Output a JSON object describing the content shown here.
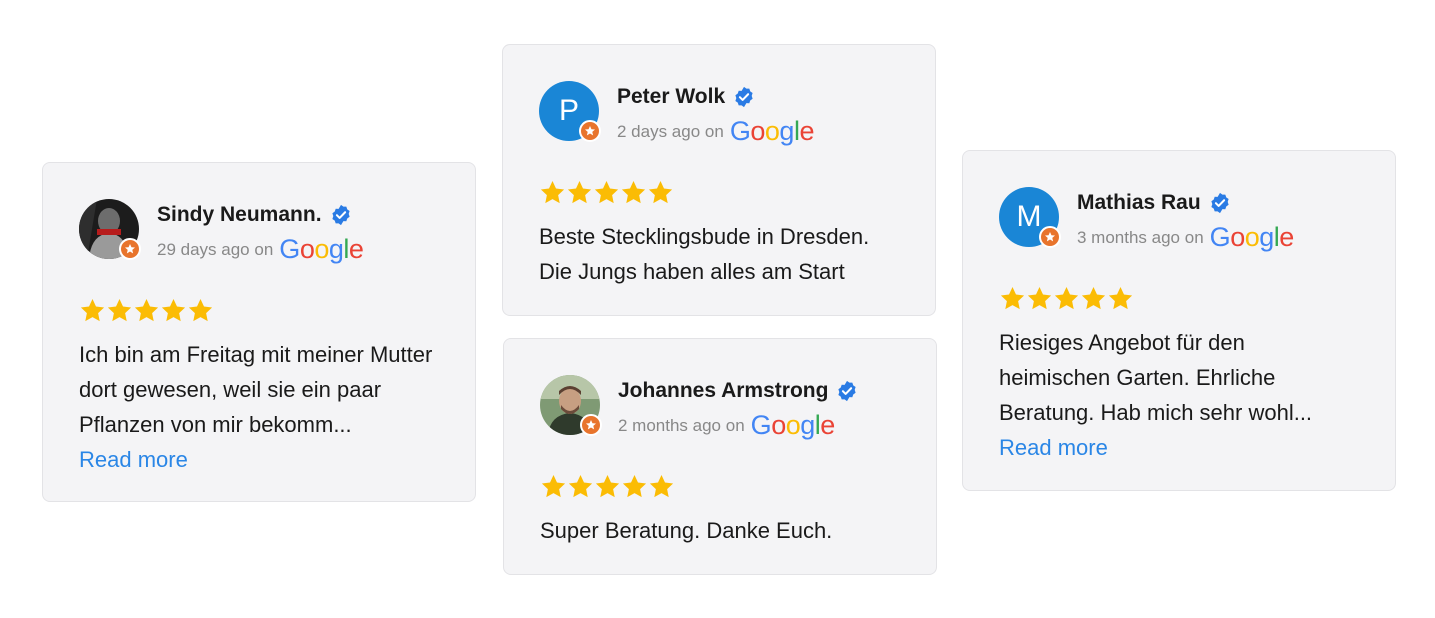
{
  "source_label": "Google",
  "on_label": "on",
  "read_more_label": "Read more",
  "colors": {
    "card_bg": "#f4f4f6",
    "star": "#fbbc04",
    "verified": "#2a7be4",
    "link": "#2a86e6",
    "avatar_letter_bg": "#1a86d6",
    "badge": "#e8742c"
  },
  "reviews": [
    {
      "name": "Sindy Neumann.",
      "time": "29 days ago",
      "rating": 5,
      "text": "Ich bin am Freitag mit meiner Mutter dort gewesen, weil sie ein paar Pflanzen von mir bekomm...",
      "avatar_type": "photo",
      "has_read_more": true
    },
    {
      "name": "Peter Wolk",
      "time": "2 days ago",
      "rating": 5,
      "text": "Beste Stecklingsbude in Dresden. Die Jungs haben alles am Start",
      "avatar_type": "letter",
      "avatar_letter": "P",
      "has_read_more": false
    },
    {
      "name": "Johannes Armstrong",
      "time": "2 months ago",
      "rating": 5,
      "text": "Super Beratung. Danke Euch.",
      "avatar_type": "photo",
      "has_read_more": false
    },
    {
      "name": "Mathias Rau",
      "time": "3 months ago",
      "rating": 5,
      "text": "Riesiges Angebot für den heimischen Garten. Ehrliche Beratung. Hab mich sehr wohl...",
      "avatar_type": "letter",
      "avatar_letter": "M",
      "has_read_more": true
    }
  ]
}
